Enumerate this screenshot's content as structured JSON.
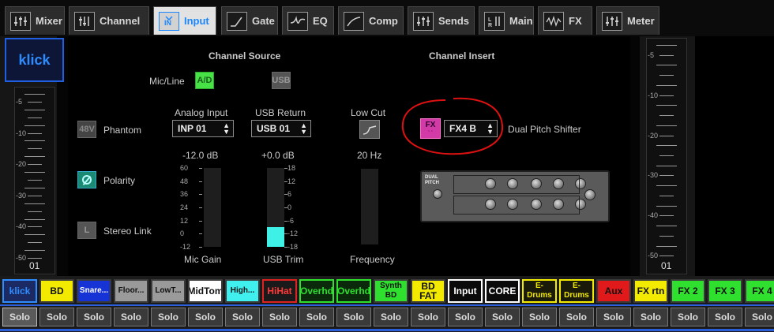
{
  "tabs": [
    {
      "label": "Mixer"
    },
    {
      "label": "Channel"
    },
    {
      "label": "Input"
    },
    {
      "label": "Gate"
    },
    {
      "label": "EQ"
    },
    {
      "label": "Comp"
    },
    {
      "label": "Sends"
    },
    {
      "label": "Main"
    },
    {
      "label": "FX"
    },
    {
      "label": "Meter"
    }
  ],
  "active_tab": "Input",
  "accent": "#1a86ff",
  "channel": {
    "name": "klick",
    "number": "01"
  },
  "left_meter": {
    "labels": [
      "-5",
      "-10",
      "-20",
      "-30",
      "-40",
      "-50"
    ]
  },
  "right_meter": {
    "labels": [
      "-5",
      "-10",
      "-20",
      "-30",
      "-40",
      "-50"
    ]
  },
  "channel_source": {
    "title": "Channel Source",
    "mic_line_label": "Mic/Line",
    "ad_button": "A/D",
    "usb_button": "USB",
    "phantom": {
      "button": "48V",
      "label": "Phantom"
    },
    "polarity": {
      "label": "Polarity"
    },
    "stereo_link": {
      "button": "L",
      "label": "Stereo Link"
    },
    "analog_input": {
      "label": "Analog Input",
      "value": "INP 01"
    },
    "usb_return": {
      "label": "USB Return",
      "value": "USB 01"
    },
    "mic_gain": {
      "value": "-12.0 dB",
      "label": "Mic Gain",
      "scale": [
        "60",
        "48",
        "36",
        "24",
        "12",
        "0",
        "-12"
      ]
    },
    "usb_trim": {
      "value": "+0.0 dB",
      "label": "USB Trim",
      "scale": [
        "18",
        "12",
        "6",
        "0",
        "-6",
        "-12",
        "-18"
      ],
      "level": 0.5
    }
  },
  "low_cut": {
    "label": "Low Cut",
    "value": "20 Hz",
    "freq_label": "Frequency"
  },
  "channel_insert": {
    "title": "Channel Insert",
    "fx_button": "FX",
    "fx_select": "FX4 B",
    "fx_name": "Dual Pitch Shifter",
    "plugin_title": "DUAL PITCH"
  },
  "strip": [
    {
      "name": "klick",
      "bg": "#1c2a64",
      "fg": "#2f8cff",
      "border": "#2f8cff"
    },
    {
      "name": "BD",
      "bg": "#f2ea00",
      "fg": "#111",
      "border": "#3a3a3a"
    },
    {
      "name": "Snare...",
      "bg": "#1633d6",
      "fg": "#ffffff",
      "border": "#3a3a3a"
    },
    {
      "name": "Floor...",
      "bg": "#9a9a9a",
      "fg": "#111",
      "border": "#3a3a3a"
    },
    {
      "name": "LowT...",
      "bg": "#9a9a9a",
      "fg": "#111",
      "border": "#3a3a3a"
    },
    {
      "name": "MidTom",
      "bg": "#ffffff",
      "fg": "#111",
      "border": "#3a3a3a"
    },
    {
      "name": "High...",
      "bg": "#3ff0ee",
      "fg": "#111",
      "border": "#3a3a3a"
    },
    {
      "name": "HiHat",
      "bg": "#1a1a1a",
      "fg": "#ff3a3a",
      "border": "#d22"
    },
    {
      "name": "Overhd",
      "bg": "#0b2a0b",
      "fg": "#2fe02f",
      "border": "#2fe02f"
    },
    {
      "name": "Overhd",
      "bg": "#0b2a0b",
      "fg": "#2fe02f",
      "border": "#2fe02f"
    },
    {
      "name": "Synth BD",
      "bg": "#2fe02f",
      "fg": "#111",
      "border": "#3a3a3a"
    },
    {
      "name": "BD FAT",
      "bg": "#f2ea00",
      "fg": "#111",
      "border": "#3a3a3a"
    },
    {
      "name": "Input",
      "bg": "#0a0a0a",
      "fg": "#ffffff",
      "border": "#ffffff"
    },
    {
      "name": "CORE",
      "bg": "#0a0a0a",
      "fg": "#ffffff",
      "border": "#ffffff"
    },
    {
      "name": "E-Drums",
      "bg": "#1a1a0a",
      "fg": "#f2ea00",
      "border": "#f2ea00"
    },
    {
      "name": "E-Drums",
      "bg": "#1a1a0a",
      "fg": "#f2ea00",
      "border": "#f2ea00"
    },
    {
      "name": "Aux",
      "bg": "#e01a1a",
      "fg": "#111",
      "border": "#3a3a3a"
    },
    {
      "name": "FX rtn",
      "bg": "#f2ea00",
      "fg": "#111",
      "border": "#3a3a3a"
    },
    {
      "name": "FX 2",
      "bg": "#2fe02f",
      "fg": "#111",
      "border": "#3a3a3a"
    },
    {
      "name": "FX 3",
      "bg": "#2fe02f",
      "fg": "#111",
      "border": "#3a3a3a"
    },
    {
      "name": "FX 4",
      "bg": "#2fe02f",
      "fg": "#111",
      "border": "#3a3a3a"
    }
  ],
  "solo_label": "Solo"
}
